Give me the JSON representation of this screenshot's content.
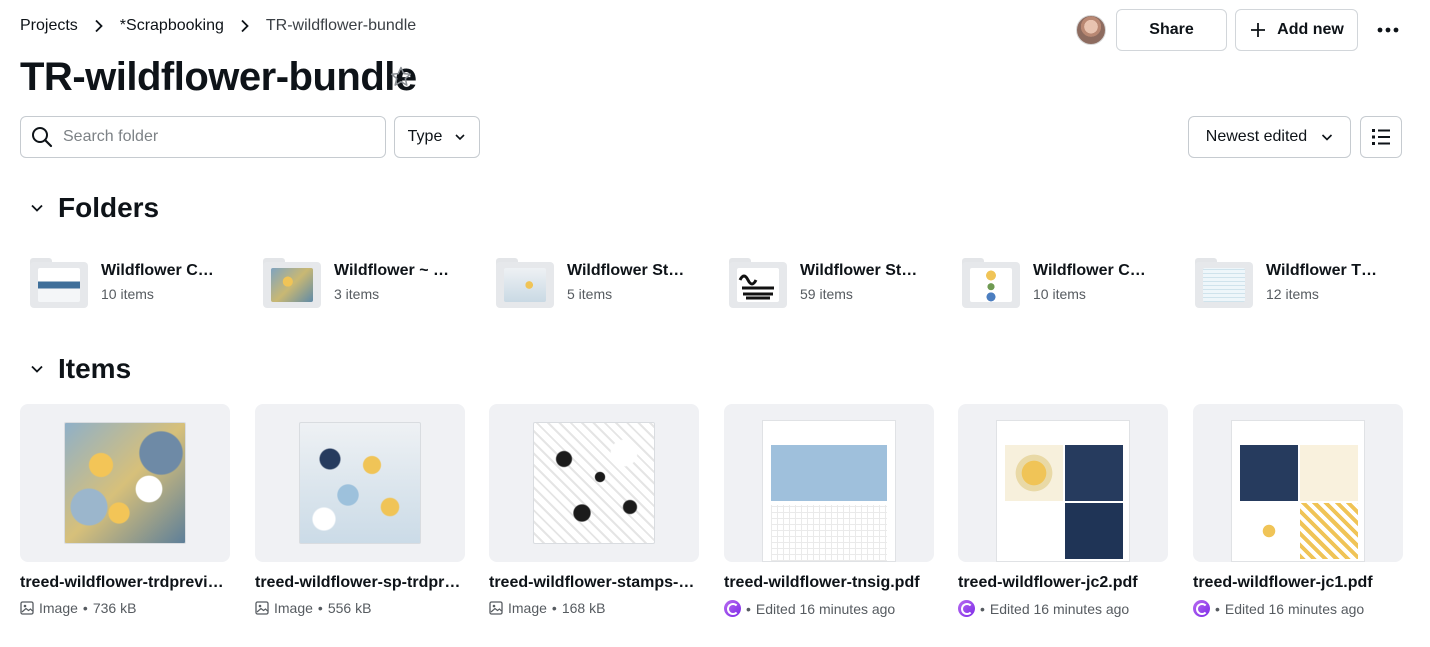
{
  "breadcrumb": {
    "items": [
      "Projects",
      "*Scrapbooking",
      "TR-wildflower-bundle"
    ]
  },
  "header": {
    "title": "TR-wildflower-bundle",
    "share_label": "Share",
    "add_new_label": "Add new"
  },
  "toolbar": {
    "search_placeholder": "Search folder",
    "search_value": "",
    "type_label": "Type",
    "sort_label": "Newest edited"
  },
  "sections": {
    "folders_label": "Folders",
    "items_label": "Items"
  },
  "folders": [
    {
      "name": "Wildflower Cards",
      "count": "10 items"
    },
    {
      "name": "Wildflower ~ Traveler's Notebook",
      "count": "3 items"
    },
    {
      "name": "Wildflower Stickers",
      "count": "5 items"
    },
    {
      "name": "Wildflower Stamps",
      "count": "59 items"
    },
    {
      "name": "Wildflower Cards",
      "count": "10 items"
    },
    {
      "name": "Wildflower TN Signatures",
      "count": "12 items"
    }
  ],
  "items": [
    {
      "name": "treed-wildflower-trdpreview.jpg",
      "type": "Image",
      "detail": "736 kB"
    },
    {
      "name": "treed-wildflower-sp-trdpreview.jpg",
      "type": "Image",
      "detail": "556 kB"
    },
    {
      "name": "treed-wildflower-stamps-trdpreview.jpg",
      "type": "Image",
      "detail": "168 kB"
    },
    {
      "name": "treed-wildflower-tnsig.pdf",
      "type": "",
      "detail": "Edited 16 minutes ago"
    },
    {
      "name": "treed-wildflower-jc2.pdf",
      "type": "",
      "detail": "Edited 16 minutes ago"
    },
    {
      "name": "treed-wildflower-jc1.pdf",
      "type": "",
      "detail": "Edited 16 minutes ago"
    }
  ],
  "colors": {
    "text": "#0e1318",
    "muted": "#565b60",
    "border": "#c6cbd0",
    "thumb_bg": "#f0f1f4",
    "canva_purple": "#7d2ae8"
  },
  "icons": [
    "chevron-right-icon",
    "plus-icon",
    "more-horizontal-icon",
    "star-icon",
    "search-icon",
    "chevron-down-icon",
    "list-view-icon",
    "image-icon",
    "canva-design-icon"
  ]
}
